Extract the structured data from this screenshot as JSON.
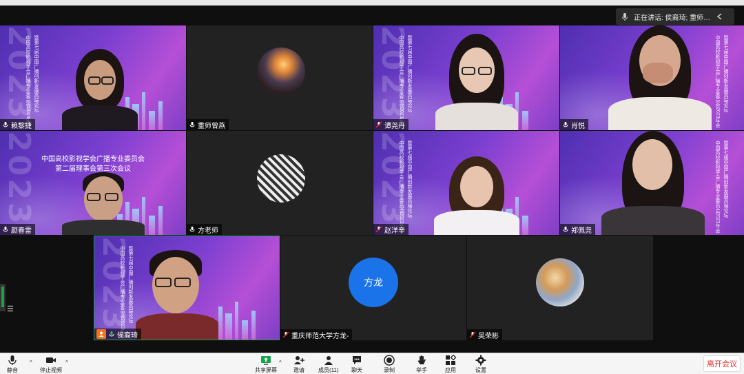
{
  "topbar": {
    "speaking_text": "正在讲话: 侯裔琦; 重师曾..."
  },
  "tiles": [
    {
      "name": "赖黎捷"
    },
    {
      "name": "重师曾燕"
    },
    {
      "name": "谭尧丹"
    },
    {
      "name": "肖悦"
    },
    {
      "name": "颜春雷"
    },
    {
      "name": "方老师"
    },
    {
      "name": "赵洋辛"
    },
    {
      "name": "郑佩尧"
    },
    {
      "name": "侯裔琦"
    },
    {
      "name": "重庆师范大学方龙-"
    },
    {
      "name": "吴荣彬"
    }
  ],
  "slide": {
    "title_line1": "中国高校影视学会广播专业委员会",
    "title_line2": "第二届理事会第三次会议",
    "vertical_line1": "中国高校影视学会广播专业委员会2023年会",
    "vertical_line2": "暨第七届中国广播创新发展高端论坛",
    "year": "2023"
  },
  "avatar_label": "方龙",
  "toolbar": {
    "mute": "静音",
    "stop_video": "停止视频",
    "share_screen": "共享屏幕",
    "invite": "邀请",
    "members": "成员(11)",
    "chat": "聊天",
    "record": "录制",
    "raise_hand": "举手",
    "apps": "应用",
    "settings": "设置",
    "leave": "离开会议"
  },
  "colors": {
    "accent_green": "#16a34a",
    "avatar_blue": "#1a73e8",
    "leave_red": "#e0322f"
  }
}
